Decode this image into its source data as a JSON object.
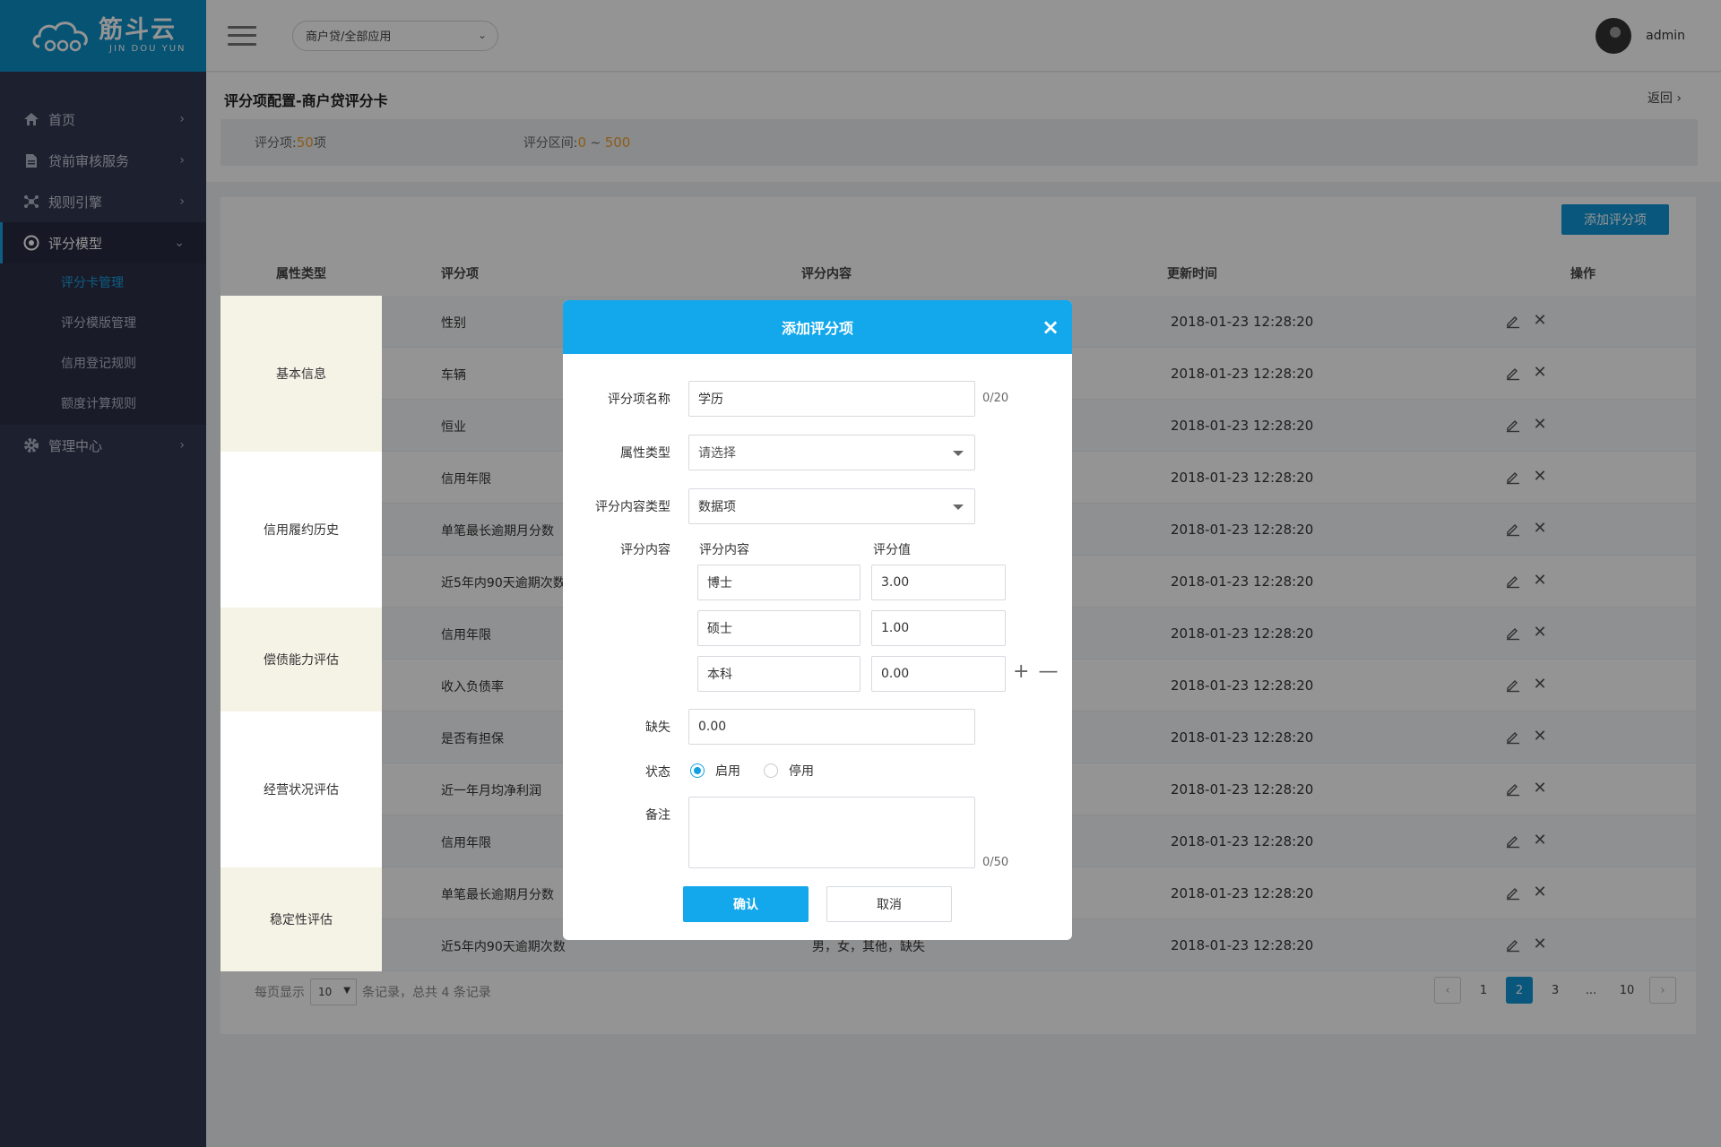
{
  "brand": {
    "name_cn": "筋斗云",
    "name_en": "JIN DOU YUN"
  },
  "header": {
    "app_select": "商户贷/全部应用",
    "username": "admin"
  },
  "sidebar": {
    "items": [
      {
        "label": "首页",
        "icon": "home-icon"
      },
      {
        "label": "贷前审核服务",
        "icon": "document-icon"
      },
      {
        "label": "规则引擎",
        "icon": "network-icon"
      },
      {
        "label": "评分模型",
        "icon": "target-icon",
        "active": true
      },
      {
        "label": "管理中心",
        "icon": "gear-icon"
      }
    ],
    "sub_items": [
      {
        "label": "评分卡管理",
        "active": true
      },
      {
        "label": "评分模版管理"
      },
      {
        "label": "信用登记规则"
      },
      {
        "label": "额度计算规则"
      }
    ]
  },
  "page": {
    "title": "评分项配置-商户贷评分卡",
    "back": "返回",
    "summary": {
      "items_label": "评分项:",
      "items_count": "50",
      "items_unit": "项",
      "range_label": "评分区间:",
      "range_min": "0",
      "range_sep": "~",
      "range_max": "500"
    }
  },
  "table": {
    "add_button": "添加评分项",
    "headers": [
      "属性类型",
      "评分项",
      "评分内容",
      "更新时间",
      "操作"
    ],
    "groups": [
      "基本信息",
      "信用履约历史",
      "偿债能力评估",
      "经营状况评估",
      "稳定性评估"
    ],
    "rows": [
      {
        "name": "性别",
        "content": "",
        "time": "2018-01-23 12:28:20"
      },
      {
        "name": "车辆",
        "content": "",
        "time": "2018-01-23 12:28:20"
      },
      {
        "name": "恒业",
        "content": "",
        "time": "2018-01-23 12:28:20"
      },
      {
        "name": "信用年限",
        "content": "",
        "time": "2018-01-23 12:28:20"
      },
      {
        "name": "单笔最长逾期月分数",
        "content": "",
        "time": "2018-01-23 12:28:20"
      },
      {
        "name": "近5年内90天逾期次数",
        "content": "",
        "time": "2018-01-23 12:28:20"
      },
      {
        "name": "信用年限",
        "content": "",
        "time": "2018-01-23 12:28:20"
      },
      {
        "name": "收入负债率",
        "content": "",
        "time": "2018-01-23 12:28:20"
      },
      {
        "name": "是否有担保",
        "content": "",
        "time": "2018-01-23 12:28:20"
      },
      {
        "name": "近一年月均净利润",
        "content": "",
        "time": "2018-01-23 12:28:20"
      },
      {
        "name": "信用年限",
        "content": "",
        "time": "2018-01-23 12:28:20"
      },
      {
        "name": "单笔最长逾期月分数",
        "content": "",
        "time": "2018-01-23 12:28:20"
      },
      {
        "name": "近5年内90天逾期次数",
        "content": "男，女，其他，缺失",
        "time": "2018-01-23 12:28:20"
      }
    ]
  },
  "pagination": {
    "per_page_label": "每页显示",
    "per_page_value": "10",
    "records_text": "条记录，总共 4 条记录",
    "pages": [
      "1",
      "2",
      "3",
      "...",
      "10"
    ],
    "current": "2"
  },
  "modal": {
    "title": "添加评分项",
    "name_label": "评分项名称",
    "name_value": "学历",
    "name_counter": "0/20",
    "attr_label": "属性类型",
    "attr_placeholder": "请选择",
    "content_type_label": "评分内容类型",
    "content_type_value": "数据项",
    "content_label": "评分内容",
    "col_content": "评分内容",
    "col_value": "评分值",
    "entries": [
      {
        "content": "博士",
        "value": "3.00"
      },
      {
        "content": "硕士",
        "value": "1.00"
      },
      {
        "content": "本科",
        "value": "0.00"
      }
    ],
    "missing_label": "缺失",
    "missing_value": "0.00",
    "status_label": "状态",
    "status_on": "启用",
    "status_off": "停用",
    "remark_label": "备注",
    "remark_counter": "0/50",
    "confirm": "确认",
    "cancel": "取消"
  }
}
